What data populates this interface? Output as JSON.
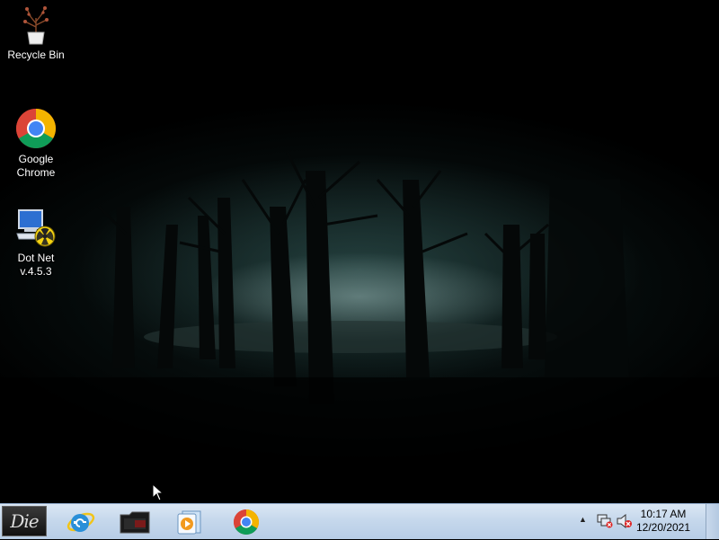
{
  "desktop": {
    "wallpaper": "dark misty forest",
    "icons": [
      {
        "label": "Recycle Bin",
        "icon": "recycle-bin-icon"
      },
      {
        "label": "Google Chrome",
        "line1": "Google",
        "line2": "Chrome",
        "icon": "chrome-icon"
      },
      {
        "label": "Dot Net v.4.5.3",
        "line1": "Dot Net",
        "line2": "v.4.5.3",
        "icon": "dotnet-installer-icon"
      }
    ]
  },
  "taskbar": {
    "start_label": "Die",
    "pinned": [
      {
        "name": "Internet Explorer",
        "icon": "internet-explorer-icon"
      },
      {
        "name": "File Explorer",
        "icon": "folder-icon"
      },
      {
        "name": "Windows Media Player",
        "icon": "media-player-icon"
      },
      {
        "name": "Google Chrome",
        "icon": "chrome-icon"
      }
    ],
    "tray": {
      "show_hidden": "▲",
      "icons": [
        "network-icon",
        "volume-muted-icon"
      ],
      "time": "10:17 AM",
      "date": "12/20/2021"
    }
  },
  "colors": {
    "taskbar": "#c6d8ec",
    "chrome_red": "#db4437",
    "chrome_green": "#0f9d58",
    "chrome_yellow": "#f4b400",
    "chrome_blue": "#4285f4"
  }
}
